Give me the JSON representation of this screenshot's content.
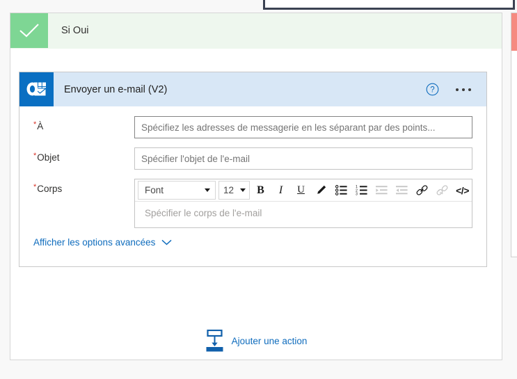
{
  "colors": {
    "scope_accent": "#7ed694",
    "scope_header_bg": "#eef7ee",
    "action_header_bg": "#d8e7f6",
    "outlook_blue": "#0a6fc2",
    "link_blue": "#0f6cbd",
    "required_red": "#d93025",
    "branch_no_accent": "#f58a80",
    "panel_border": "#3b4252"
  },
  "scope": {
    "title": "Si Oui",
    "status_icon": "checkmark-icon"
  },
  "action": {
    "title": "Envoyer un e-mail (V2)",
    "app_icon": "outlook-icon",
    "help_icon": "help-circle-icon",
    "more_icon": "ellipsis-icon",
    "fields": {
      "to": {
        "label": "À",
        "required": true,
        "placeholder": "Spécifiez les adresses de messagerie en les séparant par des points...",
        "value": ""
      },
      "subject": {
        "label": "Objet",
        "required": true,
        "placeholder": "Spécifier l'objet de l'e-mail",
        "value": ""
      },
      "body": {
        "label": "Corps",
        "required": true,
        "placeholder": "Spécifier le corps de l'e-mail",
        "value": ""
      }
    },
    "editor_toolbar": {
      "font_name": "Font",
      "font_size": "12",
      "buttons": [
        {
          "name": "bold-icon",
          "glyph": "B",
          "enabled": true
        },
        {
          "name": "italic-icon",
          "glyph": "I",
          "enabled": true
        },
        {
          "name": "underline-icon",
          "glyph": "U",
          "enabled": true
        },
        {
          "name": "text-highlight-pen-icon",
          "glyph": "",
          "enabled": true
        },
        {
          "name": "bulleted-list-icon",
          "glyph": "",
          "enabled": true
        },
        {
          "name": "numbered-list-icon",
          "glyph": "",
          "enabled": true
        },
        {
          "name": "increase-indent-icon",
          "glyph": "",
          "enabled": false
        },
        {
          "name": "decrease-indent-icon",
          "glyph": "",
          "enabled": false
        },
        {
          "name": "insert-link-icon",
          "glyph": "",
          "enabled": true
        },
        {
          "name": "remove-link-icon",
          "glyph": "",
          "enabled": false
        },
        {
          "name": "code-view-icon",
          "glyph": "</>",
          "enabled": true
        }
      ]
    },
    "advanced_options": {
      "label": "Afficher les options avancées",
      "chevron_icon": "chevron-down-icon"
    }
  },
  "add_action": {
    "label": "Ajouter une action",
    "icon": "insert-action-icon"
  }
}
